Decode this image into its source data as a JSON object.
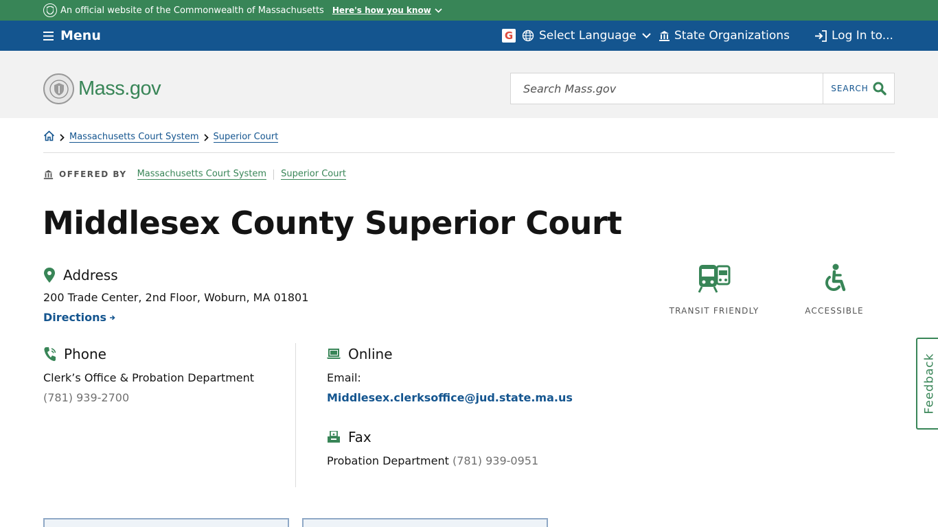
{
  "official_bar": {
    "text": "An official website of the Commonwealth of Massachusetts",
    "how_label": "Here's how you know"
  },
  "util_nav": {
    "menu_label": "Menu",
    "language_label": "Select Language",
    "orgs_label": "State Organizations",
    "login_label": "Log In to..."
  },
  "header": {
    "logo_text": "Mass.gov",
    "search_placeholder": "Search Mass.gov",
    "search_button": "SEARCH"
  },
  "breadcrumb": {
    "items": [
      "Massachusetts Court System",
      "Superior Court"
    ]
  },
  "offered_by": {
    "label": "OFFERED BY",
    "orgs": [
      "Massachusetts Court System",
      "Superior Court"
    ]
  },
  "page_title": "Middlesex County Superior Court",
  "address": {
    "heading": "Address",
    "value": "200 Trade Center, 2nd Floor, Woburn, MA 01801",
    "directions_label": "Directions"
  },
  "phone": {
    "heading": "Phone",
    "label": "Clerk’s Office & Probation Department",
    "number": "(781) 939-2700"
  },
  "online": {
    "heading": "Online",
    "label": "Email:",
    "email": "Middlesex.clerksoffice@jud.state.ma.us"
  },
  "fax": {
    "heading": "Fax",
    "label": "Probation Department",
    "number": "(781) 939-0951"
  },
  "amenities": [
    "TRANSIT FRIENDLY",
    "ACCESSIBLE"
  ],
  "feedback_label": "Feedback",
  "colors": {
    "green": "#388557",
    "blue": "#14558f",
    "gray_bg": "#f2f2f2"
  }
}
